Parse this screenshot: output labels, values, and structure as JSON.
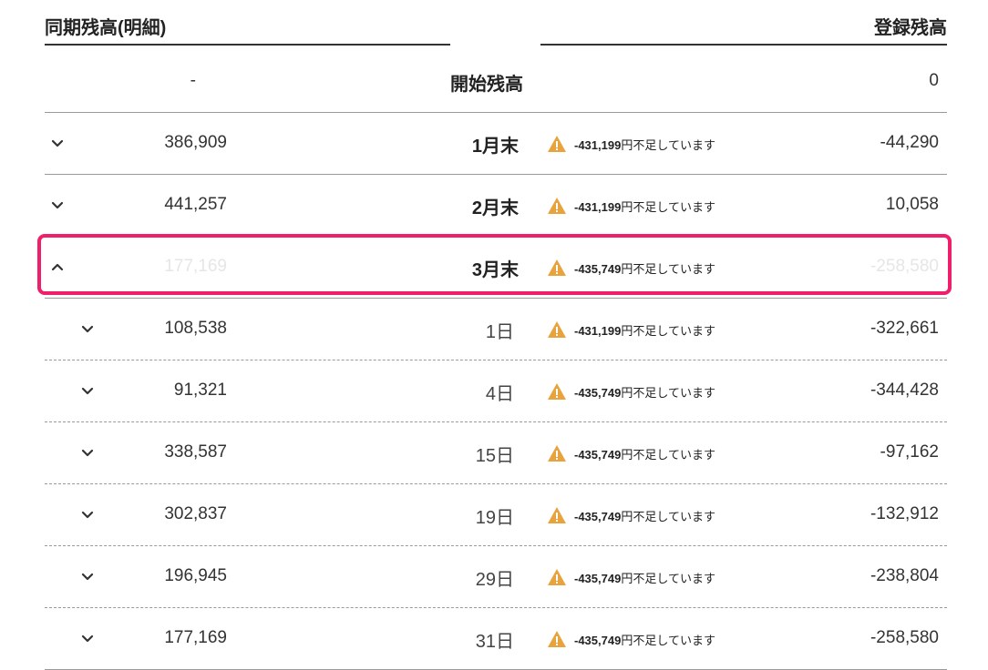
{
  "header": {
    "left_title": "同期残高(明細)",
    "right_title": "登録残高"
  },
  "start_row": {
    "left": "-",
    "label": "開始残高",
    "right": "0"
  },
  "months": [
    {
      "left": "386,909",
      "label": "1月末",
      "warning": "-431,199",
      "warning_suffix": "円不足しています",
      "right": "-44,290",
      "expanded": false
    },
    {
      "left": "441,257",
      "label": "2月末",
      "warning": "-431,199",
      "warning_suffix": "円不足しています",
      "right": "10,058",
      "expanded": false
    },
    {
      "left": "177,169",
      "label": "3月末",
      "warning": "-435,749",
      "warning_suffix": "円不足しています",
      "right": "-258,580",
      "expanded": true
    }
  ],
  "days": [
    {
      "left": "108,538",
      "label": "1日",
      "warning": "-431,199",
      "warning_suffix": "円不足しています",
      "right": "-322,661"
    },
    {
      "left": "91,321",
      "label": "4日",
      "warning": "-435,749",
      "warning_suffix": "円不足しています",
      "right": "-344,428"
    },
    {
      "left": "338,587",
      "label": "15日",
      "warning": "-435,749",
      "warning_suffix": "円不足しています",
      "right": "-97,162"
    },
    {
      "left": "302,837",
      "label": "19日",
      "warning": "-435,749",
      "warning_suffix": "円不足しています",
      "right": "-132,912"
    },
    {
      "left": "196,945",
      "label": "29日",
      "warning": "-435,749",
      "warning_suffix": "円不足しています",
      "right": "-238,804"
    },
    {
      "left": "177,169",
      "label": "31日",
      "warning": "-435,749",
      "warning_suffix": "円不足しています",
      "right": "-258,580"
    }
  ],
  "colors": {
    "warning": "#e8a33d",
    "highlight": "#f01f6b"
  },
  "icons": {
    "collapsed": "chevron-down-icon",
    "expanded": "chevron-up-icon",
    "warning": "warning-triangle-icon"
  }
}
